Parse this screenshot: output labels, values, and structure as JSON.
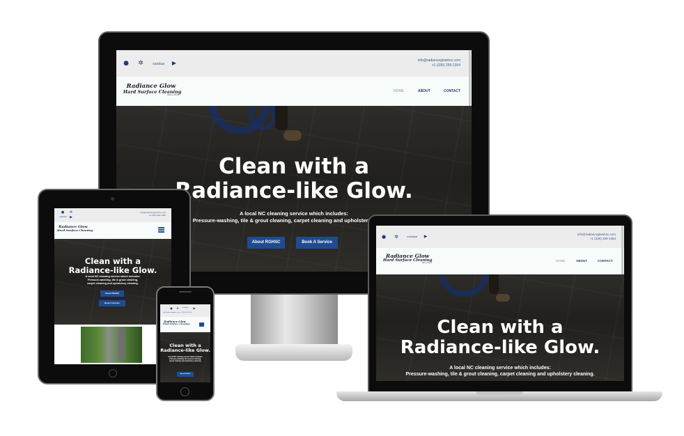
{
  "site": {
    "email": "info@radianceglowhsc.com",
    "phone": "+1 (336) 259-1354",
    "logo": {
      "line1": "Radiance Glow",
      "line2": "Hard Surface Cleaning",
      "line3": "Since 2019"
    },
    "nav": {
      "home": "HOME",
      "about": "ABOUT",
      "contact": "CONTACT"
    },
    "hero": {
      "title_line1": "Clean with a",
      "title_line2": "Radiance-like Glow.",
      "sub_line1": "A local NC cleaning service which includes:",
      "sub_line2": "Pressure-washing, tile & grout cleaning, carpet cleaning and upholstery cleaning."
    },
    "tablet_hero": {
      "sub_line1": "A local NC cleaning service which includes:",
      "sub_line2": "Pressure-washing, tile & grout cleaning,",
      "sub_line3": "carpet cleaning and upholstery cleaning."
    },
    "phone_hero": {
      "sub_line1": "A local NC cleaning service which includes:",
      "sub_line2": "Pressure-washing, tile & grout cleaning,",
      "sub_line3": "carpet cleaning and upholstery cleaning."
    },
    "buttons": {
      "about": "About RGHSC",
      "book": "Book A Service"
    },
    "social": {
      "facebook": "facebook-icon",
      "yelp": "yelp-icon",
      "nextdoor": "nextdoor",
      "youtube": "youtube-icon"
    }
  },
  "colors": {
    "brand_blue": "#1f4c8f",
    "nav_text": "#1e3e7a",
    "nav_active": "#aab4b8",
    "topbar_bg": "#ececec",
    "hero_overlay": "#2c2b28"
  }
}
